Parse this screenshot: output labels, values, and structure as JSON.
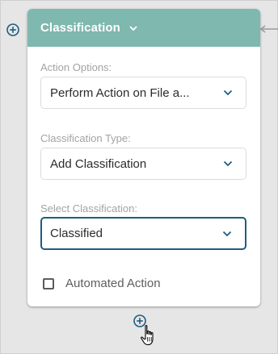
{
  "card": {
    "title": "Classification"
  },
  "fields": {
    "action_options": {
      "label": "Action Options:",
      "value": "Perform Action on File a..."
    },
    "classification_type": {
      "label": "Classification Type:",
      "value": "Add Classification"
    },
    "select_classification": {
      "label": "Select Classification:",
      "value": "Classified"
    }
  },
  "automated_action": {
    "label": "Automated Action",
    "checked": false
  },
  "icons": {
    "add_left": "plus-circle-icon",
    "add_bottom": "plus-circle-icon",
    "header_chevron": "chevron-down-icon",
    "incoming_arrow": "arrow-left-icon",
    "cursor": "hand-pointer-icon"
  },
  "colors": {
    "header_bg": "#7fb8ae",
    "accent_blue": "#1f5c80",
    "canvas_bg": "#e6e6e6"
  }
}
